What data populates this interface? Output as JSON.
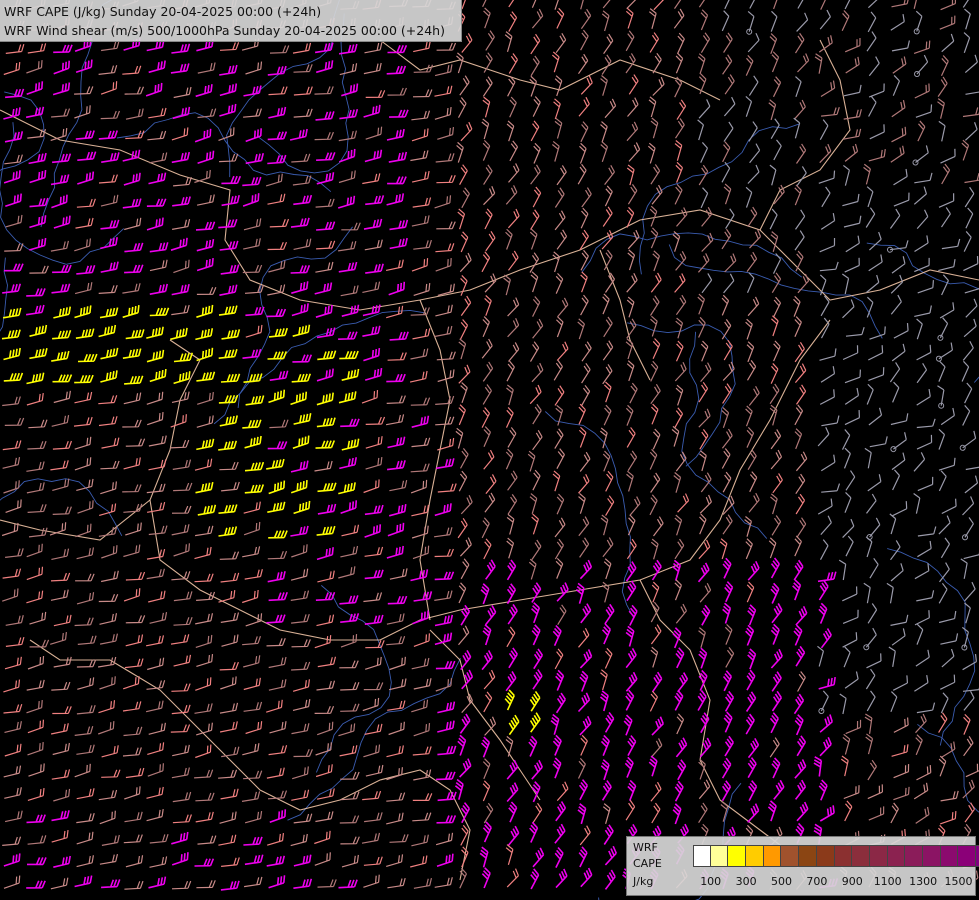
{
  "header": {
    "line1": "WRF CAPE (J/kg) Sunday 20-04-2025 00:00 (+24h)",
    "line2": "WRF Wind shear (m/s) 500/1000hPa Sunday 20-04-2025 00:00 (+24h)"
  },
  "legend": {
    "label_line1": "WRF",
    "label_line2": "CAPE",
    "label_line3": "J/kg",
    "colors": [
      "#ffffff",
      "#ffff99",
      "#ffff00",
      "#ffcc00",
      "#ff9900",
      "#a0522d",
      "#8b4513",
      "#8b3a1a",
      "#8b3030",
      "#8b2e3c",
      "#8b2846",
      "#8b2250",
      "#8b1c5a",
      "#8b1464",
      "#8b0a6e",
      "#8b0078",
      "#800080"
    ],
    "ticks": [
      "100",
      "300",
      "500",
      "700",
      "900",
      "1100",
      "1300",
      "1500"
    ]
  },
  "map": {
    "legend_colors": {
      "yellow": "#ffff00",
      "magenta": "#ee00ee",
      "salmon": "#f08080",
      "rosy": "#c88a88",
      "mauve": "#b07878",
      "grey": "#9a9aaa",
      "border": "#ffd0b0",
      "river": "#3a5cb0"
    }
  }
}
